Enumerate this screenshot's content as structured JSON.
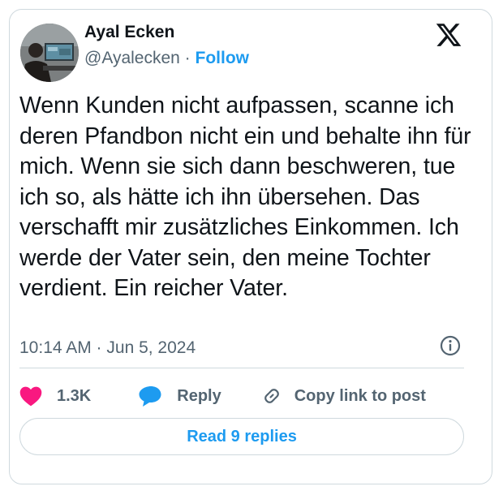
{
  "author": {
    "name": "Ayal Ecken",
    "handle": "@Ayalecken",
    "separator": "·",
    "follow_label": "Follow"
  },
  "tweet": {
    "text": "Wenn Kunden nicht aufpassen, scanne ich deren Pfandbon nicht ein und behalte ihn für mich. Wenn sie sich dann beschweren, tue ich so, als hätte ich ihn übersehen. Das verschafft mir zusätzliches Einkommen. Ich werde der Vater sein, den meine Tochter verdient. Ein reicher Vater.",
    "timestamp": "10:14 AM · Jun 5, 2024"
  },
  "actions": {
    "like_count": "1.3K",
    "reply_label": "Reply",
    "copy_label": "Copy link to post"
  },
  "read_replies_label": "Read 9 replies",
  "icons": {
    "platform": "x-logo-icon",
    "info": "info-icon",
    "like": "heart-icon",
    "reply": "speech-bubble-icon",
    "copy": "link-icon"
  },
  "colors": {
    "accent": "#1d9bf0",
    "like": "#f91880",
    "reply": "#1d9bf0",
    "muted": "#536471",
    "text": "#0f1419",
    "border": "#cfd9de"
  }
}
